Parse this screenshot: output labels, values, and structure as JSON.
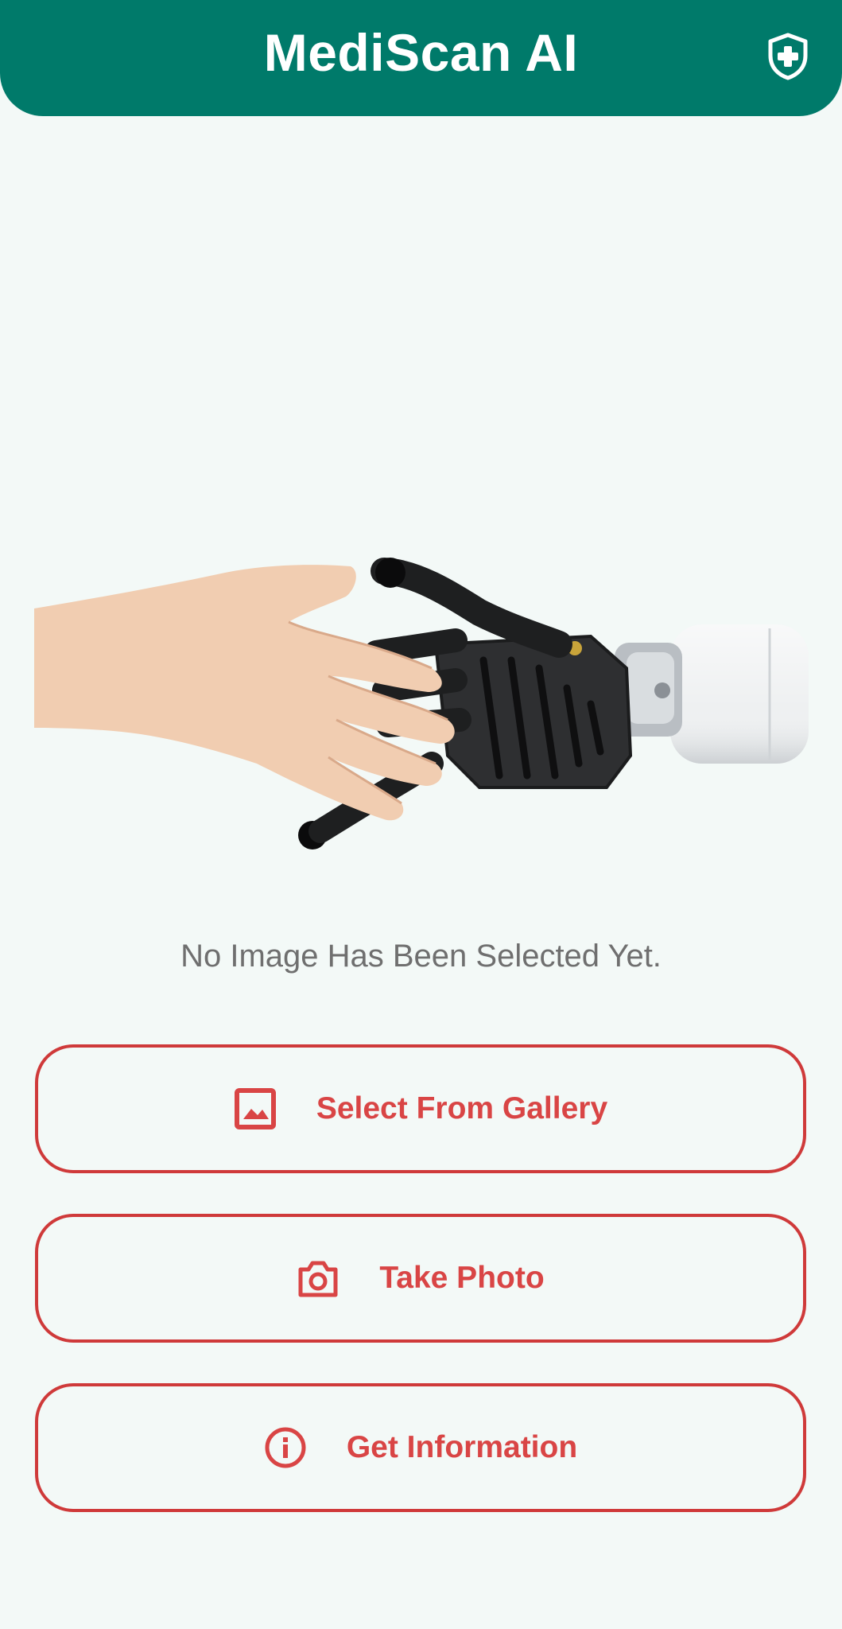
{
  "app": {
    "title": "MediScan AI",
    "accent_color": "#007a6a",
    "button_color": "#d94545",
    "header_icon": "shield-plus-icon"
  },
  "hero_image": {
    "description": "human-hand-shaking-robotic-hand"
  },
  "status": {
    "message": "No Image Has Been Selected Yet."
  },
  "actions": [
    {
      "label": "Select From Gallery",
      "icon": "image-icon"
    },
    {
      "label": "Take Photo",
      "icon": "camera-icon"
    },
    {
      "label": "Get Information",
      "icon": "info-icon"
    }
  ]
}
